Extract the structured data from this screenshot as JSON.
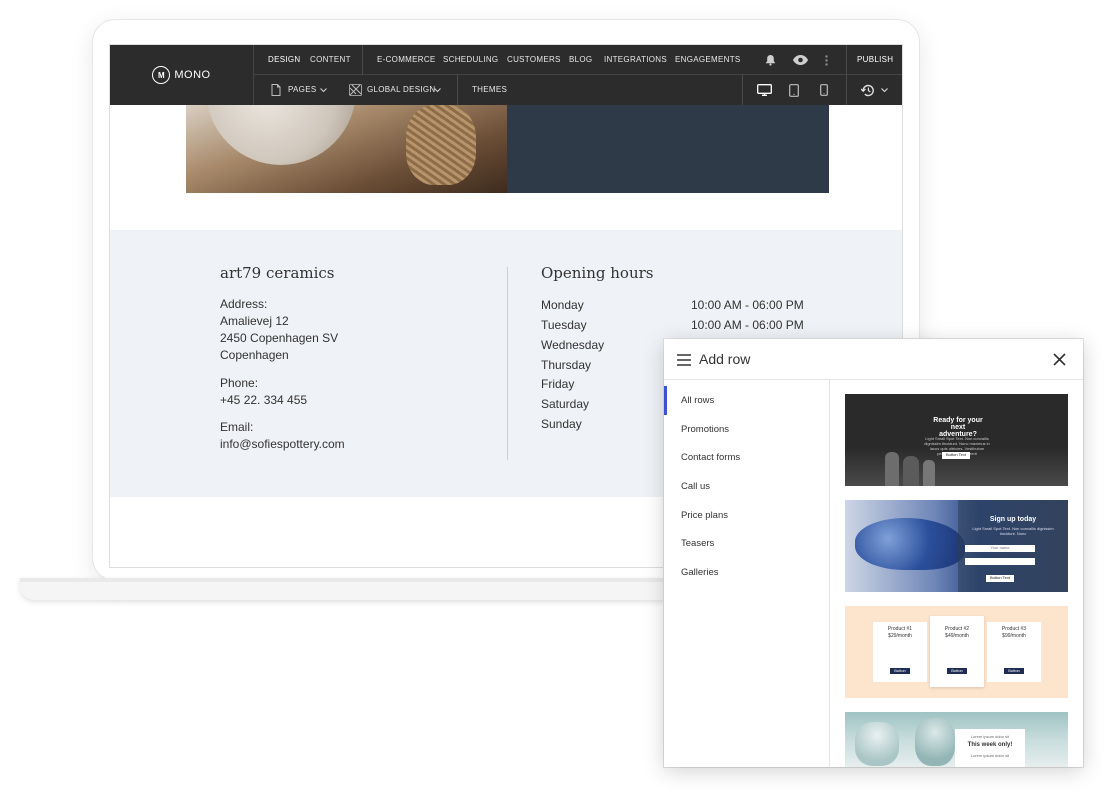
{
  "editor": {
    "logo": {
      "mark": "M",
      "name": "MONO"
    },
    "tabs": {
      "design": "DESIGN",
      "content": "CONTENT"
    },
    "nav": {
      "ecommerce": "E-COMMERCE",
      "scheduling": "SCHEDULING",
      "customers": "CUSTOMERS",
      "blog": "BLOG",
      "integrations": "INTEGRATIONS",
      "engagements": "ENGAGEMENTS"
    },
    "publish": "PUBLISH",
    "toolbar": {
      "pages": "PAGES",
      "global_design": "GLOBAL DESIGN",
      "themes": "THEMES"
    }
  },
  "site": {
    "business_name": "art79 ceramics",
    "address_label": "Address:",
    "address_lines": [
      "Amalievej 12",
      "2450 Copenhagen SV",
      "Copenhagen"
    ],
    "phone_label": "Phone:",
    "phone": "+45 22. 334 455",
    "email_label": "Email:",
    "email": "info@sofiespottery.com",
    "hours_title": "Opening hours",
    "hours": [
      {
        "day": "Monday",
        "time": "10:00 AM - 06:00 PM"
      },
      {
        "day": "Tuesday",
        "time": "10:00 AM - 06:00 PM"
      },
      {
        "day": "Wednesday",
        "time": ""
      },
      {
        "day": "Thursday",
        "time": ""
      },
      {
        "day": "Friday",
        "time": ""
      },
      {
        "day": "Saturday",
        "time": ""
      },
      {
        "day": "Sunday",
        "time": ""
      }
    ]
  },
  "add_row_panel": {
    "title": "Add row",
    "categories": [
      "All rows",
      "Promotions",
      "Contact forms",
      "Call us",
      "Price plans",
      "Teasers",
      "Galleries"
    ],
    "active_category": "All rows",
    "previews": {
      "promo": {
        "title": "Ready for your next adventure?",
        "body": "Light Small Spot Text. Non convallis dignissim tincidunt. Nunc maximus in lacus quis ultricies. Vestibulum pellentesque hendrerit",
        "button": "Button Text"
      },
      "signup": {
        "title": "Sign up today",
        "body": "Light Small Spot Text. Non convallis dignissim tincidunt. Nunc",
        "field": "Your name",
        "button": "Button Text"
      },
      "pricing": [
        {
          "name": "Product #1",
          "price": "$29/month",
          "button": "Button"
        },
        {
          "name": "Product #2",
          "price": "$49/month",
          "button": "Button"
        },
        {
          "name": "Product #3",
          "price": "$99/month",
          "button": "Button"
        }
      ],
      "teaser": {
        "pre": "Lorem ipsum dolor sit",
        "title": "This week only!",
        "post": "Lorem ipsum dolor sit"
      }
    }
  },
  "colors": {
    "toolbar": "#2c2c2c",
    "accent": "#3b52d4",
    "band": "#eff2f6"
  }
}
